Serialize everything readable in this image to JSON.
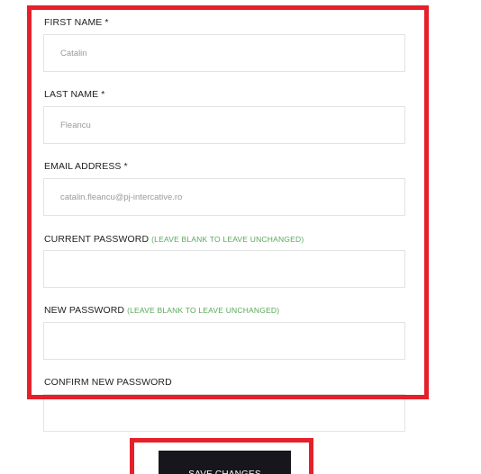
{
  "form": {
    "first_name": {
      "label": "FIRST NAME *",
      "value": "Catalin"
    },
    "last_name": {
      "label": "LAST NAME *",
      "value": "Fleancu"
    },
    "email": {
      "label": "EMAIL ADDRESS *",
      "value": "catalin.fleancu@pj-intercative.ro"
    },
    "current_password": {
      "label": "CURRENT PASSWORD",
      "hint": "(LEAVE BLANK TO LEAVE UNCHANGED)",
      "value": ""
    },
    "new_password": {
      "label": "NEW PASSWORD",
      "hint": "(LEAVE BLANK TO LEAVE UNCHANGED)",
      "value": ""
    },
    "confirm_password": {
      "label": "CONFIRM NEW PASSWORD",
      "value": ""
    },
    "save_label": "SAVE CHANGES"
  },
  "colors": {
    "highlight": "#e4202a",
    "hint": "#5aa85a",
    "button_bg": "#16161c"
  }
}
